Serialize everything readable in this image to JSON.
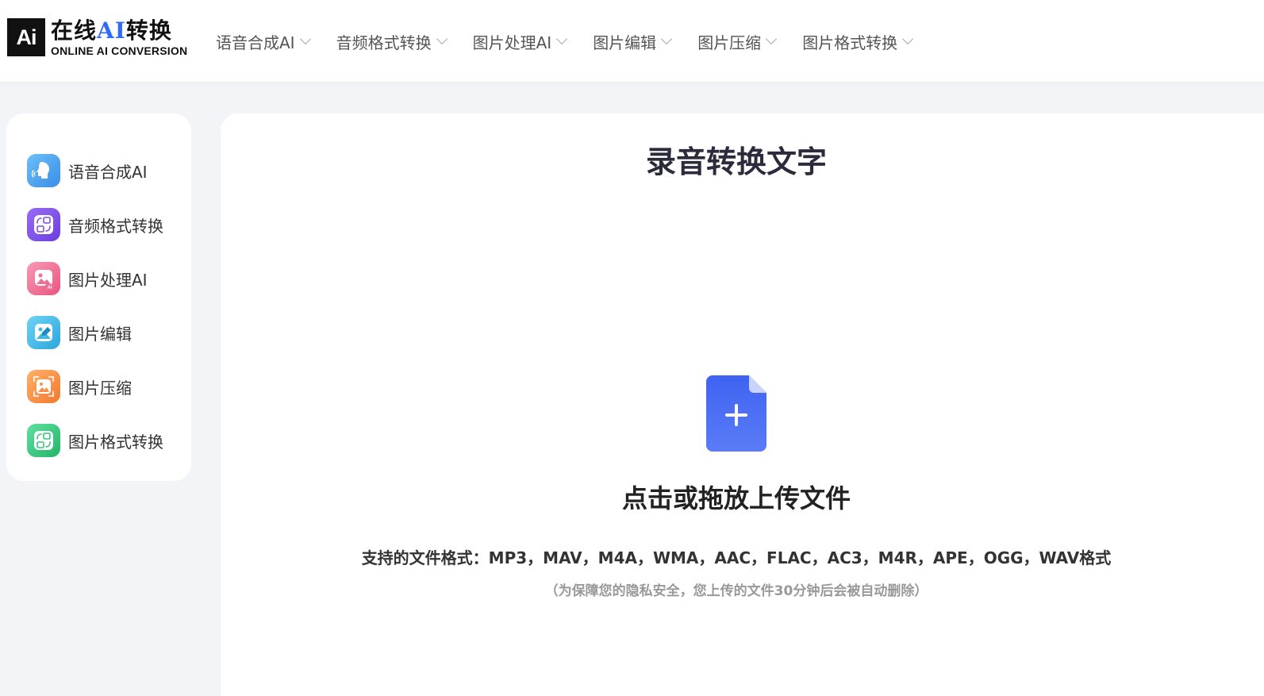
{
  "header": {
    "logo_mark": "Ai",
    "logo_cn_pre": "在线",
    "logo_cn_ai": "AI",
    "logo_cn_post": "转换",
    "logo_en": "ONLINE AI CONVERSION",
    "nav": [
      {
        "label": "语音合成AI"
      },
      {
        "label": "音频格式转换"
      },
      {
        "label": "图片处理AI"
      },
      {
        "label": "图片编辑"
      },
      {
        "label": "图片压缩"
      },
      {
        "label": "图片格式转换"
      }
    ]
  },
  "sidebar": {
    "items": [
      {
        "label": "语音合成AI",
        "icon": "voice-synthesis-icon",
        "color": "#4aa3f0"
      },
      {
        "label": "音频格式转换",
        "icon": "audio-convert-icon",
        "color": "#7b4fe8"
      },
      {
        "label": "图片处理AI",
        "icon": "image-ai-icon",
        "color": "#ee6f94"
      },
      {
        "label": "图片编辑",
        "icon": "image-edit-icon",
        "color": "#3bb8e6"
      },
      {
        "label": "图片压缩",
        "icon": "image-compress-icon",
        "color": "#f5924a"
      },
      {
        "label": "图片格式转换",
        "icon": "image-convert-icon",
        "color": "#34c77b"
      }
    ]
  },
  "main": {
    "title": "录音转换文字",
    "upload": {
      "icon": "file-add-icon",
      "title": "点击或拖放上传文件",
      "formats": "支持的文件格式：MP3，MAV，M4A，WMA，AAC，FLAC，AC3，M4R，APE，OGG，WAV格式",
      "privacy": "（为保障您的隐私安全，您上传的文件30分钟后会被自动删除）"
    }
  },
  "colors": {
    "accent": "#2f6bf4",
    "upload_icon": "#4f73f5",
    "page_bg": "#f3f4f7"
  }
}
